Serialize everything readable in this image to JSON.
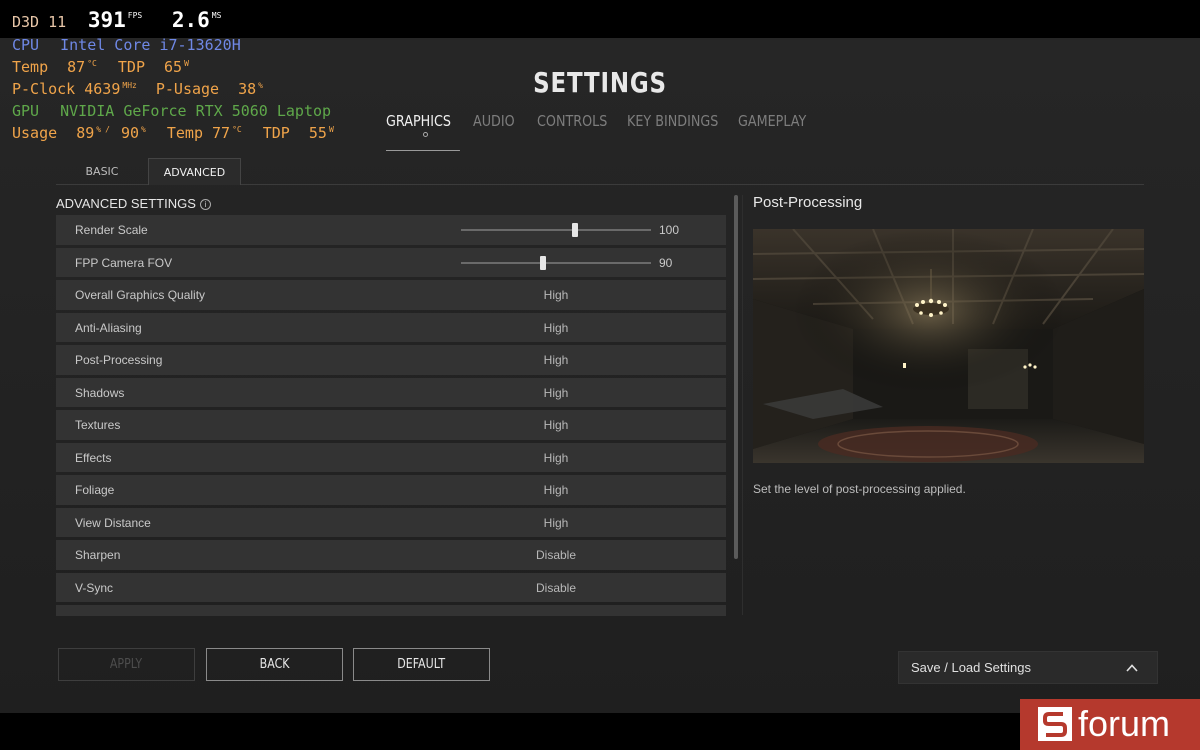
{
  "osd": {
    "api": "D3D 11",
    "fps_value": "391",
    "fps_unit": "FPS",
    "frametime_value": "2.6",
    "frametime_unit": "MS",
    "cpu_label": "CPU",
    "cpu_name": "Intel Core i7-13620H",
    "cpu_temp_label": "Temp",
    "cpu_temp_value": "87",
    "cpu_temp_unit": "°C",
    "cpu_tdp_label": "TDP",
    "cpu_tdp_value": "65",
    "cpu_tdp_unit": "W",
    "pclock_label": "P-Clock",
    "pclock_value": "4639",
    "pclock_unit": "MHz",
    "pusage_label": "P-Usage",
    "pusage_value": "38",
    "pusage_unit": "%",
    "gpu_label": "GPU",
    "gpu_name": "NVIDIA GeForce RTX 5060 Laptop",
    "usage_label": "Usage",
    "usage_value": "89",
    "usage_unit": "%",
    "usage_sep": "/",
    "usage_value2": "90",
    "usage_unit2": "%",
    "gpu_temp_label": "Temp",
    "gpu_temp_value": "77",
    "gpu_temp_unit": "°C",
    "gpu_tdp_label": "TDP",
    "gpu_tdp_value": "55",
    "gpu_tdp_unit": "W"
  },
  "header": {
    "title": "SETTINGS",
    "tabs": [
      {
        "label": "GRAPHICS",
        "active": true
      },
      {
        "label": "AUDIO",
        "active": false
      },
      {
        "label": "CONTROLS",
        "active": false
      },
      {
        "label": "KEY BINDINGS",
        "active": false
      },
      {
        "label": "GAMEPLAY",
        "active": false
      }
    ]
  },
  "subtabs": [
    {
      "label": "BASIC",
      "active": false
    },
    {
      "label": "ADVANCED",
      "active": true
    }
  ],
  "advanced": {
    "title": "ADVANCED SETTINGS",
    "info_glyph": "i",
    "sliders": [
      {
        "label": "Render Scale",
        "value": "100",
        "fraction": 0.6
      },
      {
        "label": "FPP Camera FOV",
        "value": "90",
        "fraction": 0.43
      }
    ],
    "options": [
      {
        "label": "Overall Graphics Quality",
        "value": "High"
      },
      {
        "label": "Anti-Aliasing",
        "value": "High"
      },
      {
        "label": "Post-Processing",
        "value": "High"
      },
      {
        "label": "Shadows",
        "value": "High"
      },
      {
        "label": "Textures",
        "value": "High"
      },
      {
        "label": "Effects",
        "value": "High"
      },
      {
        "label": "Foliage",
        "value": "High"
      },
      {
        "label": "View Distance",
        "value": "High"
      },
      {
        "label": "Sharpen",
        "value": "Disable"
      },
      {
        "label": "V-Sync",
        "value": "Disable"
      },
      {
        "label": "",
        "value": ""
      }
    ]
  },
  "preview": {
    "title": "Post-Processing",
    "description": "Set the level of post-processing applied."
  },
  "buttons": {
    "apply": "APPLY",
    "back": "BACK",
    "default": "DEFAULT",
    "saveload": "Save / Load Settings"
  },
  "watermark": {
    "text": "forum"
  },
  "colors": {
    "accent_orange": "#f0a44a",
    "cpu_blue": "#6f88e6",
    "gpu_green": "#5fa84a",
    "watermark_red": "#b5392d"
  }
}
